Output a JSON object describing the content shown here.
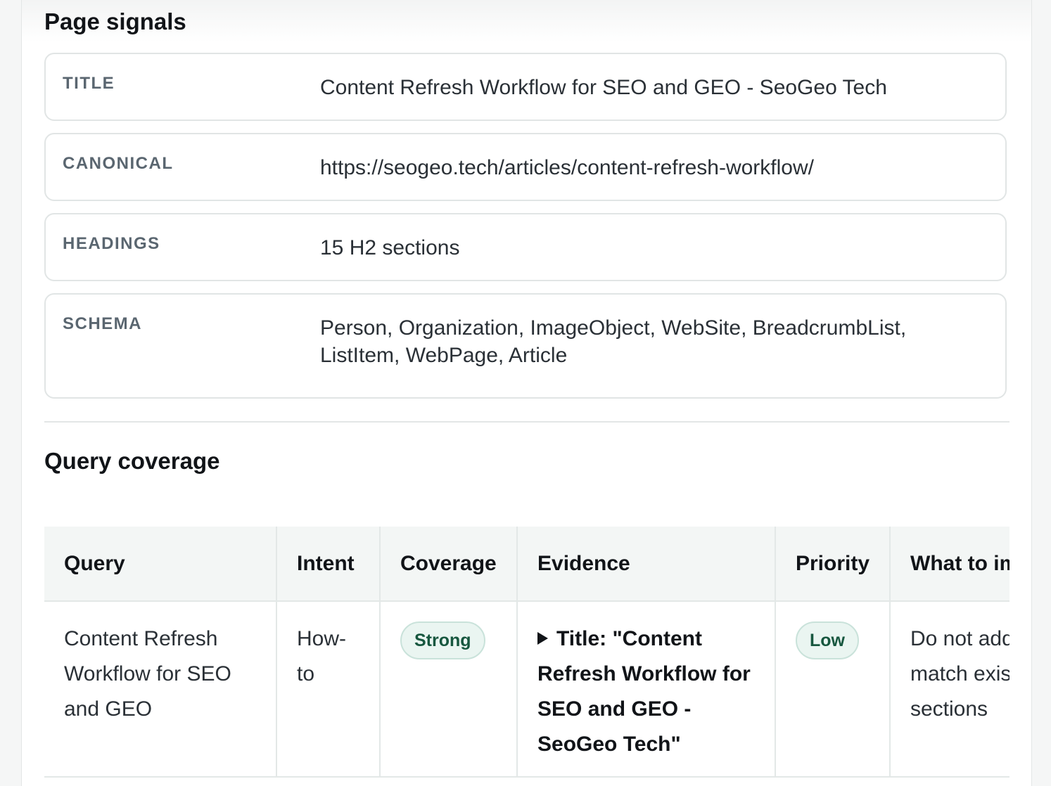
{
  "page_signals": {
    "title": "Page signals",
    "items": [
      {
        "label": "TITLE",
        "value": "Content Refresh Workflow for SEO and GEO - SeoGeo Tech"
      },
      {
        "label": "CANONICAL",
        "value": "https://seogeo.tech/articles/content-refresh-workflow/"
      },
      {
        "label": "HEADINGS",
        "value": "15 H2 sections"
      },
      {
        "label": "SCHEMA",
        "value": "Person, Organization, ImageObject, WebSite, BreadcrumbList, ListItem, WebPage, Article"
      }
    ]
  },
  "query_coverage": {
    "title": "Query coverage",
    "columns": [
      "Query",
      "Intent",
      "Coverage",
      "Evidence",
      "Priority",
      "What to improve"
    ],
    "rows": [
      {
        "query": "Content Refresh Workflow for SEO and GEO",
        "intent": "How-to",
        "coverage": "Strong",
        "evidence": "Title: \"Content Refresh Workflow for SEO and GEO - SeoGeo Tech\"",
        "priority": "Low",
        "improve": "Do not add or exact-match existing sections"
      }
    ]
  },
  "colors": {
    "badge_bg": "#eaf5f1",
    "badge_text": "#17573f",
    "label_text": "#5a6670"
  }
}
